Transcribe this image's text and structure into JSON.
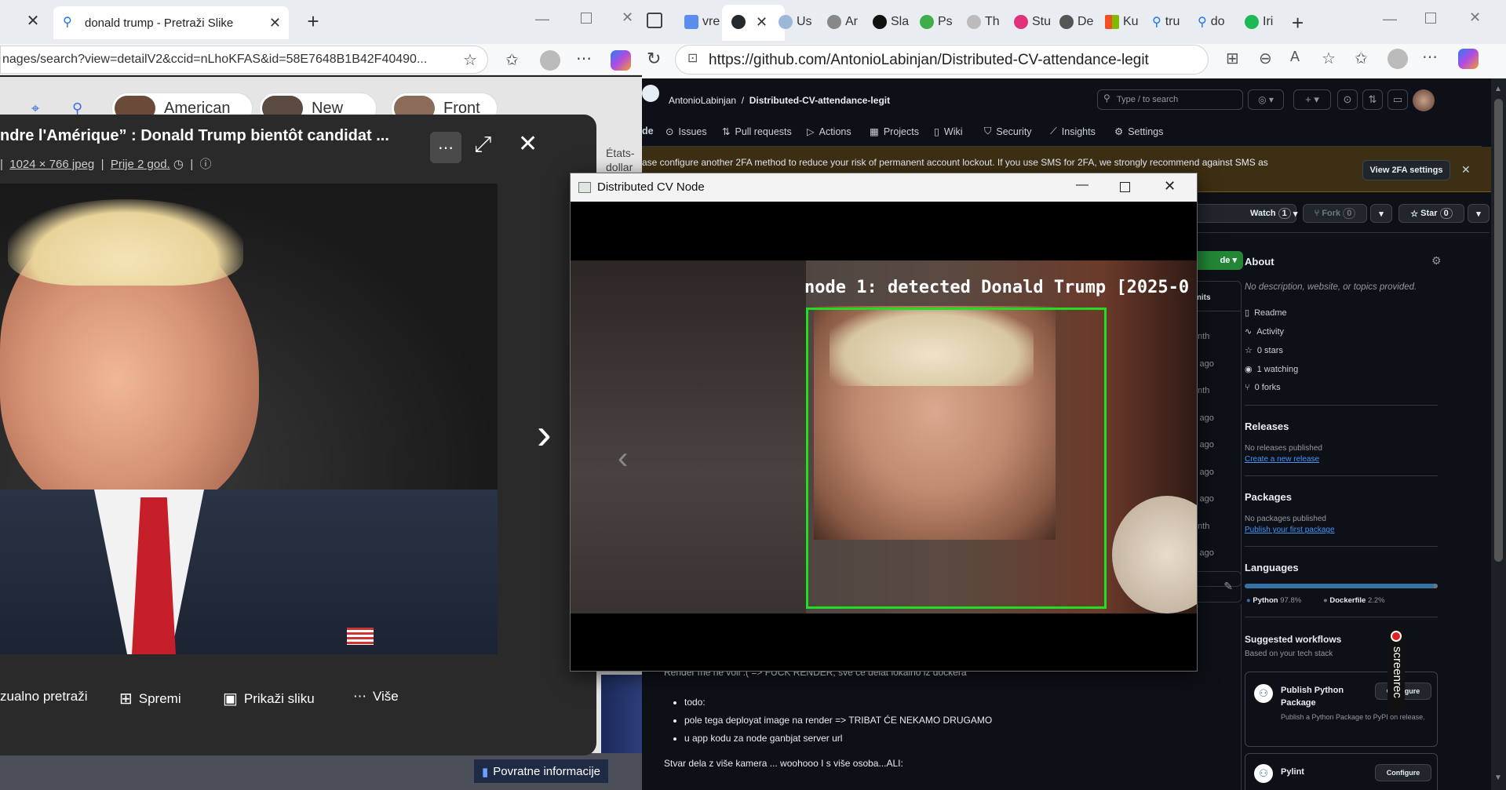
{
  "left_browser": {
    "tab_title": "donald trump - Pretraži Slike",
    "url": "nages/search?view=detailV2&ccid=nLhoKFAS&id=58E7648B1B42F40490...",
    "chips": [
      "American",
      "New",
      "Front"
    ],
    "image_title": "ndre l'Amérique” : Donald Trump bientôt candidat ...",
    "image_size": "1024 × 766 jpeg",
    "image_age": "Prije 2 god.",
    "side_text": [
      "États-",
      "dollar"
    ],
    "actions": [
      "zualno pretraži",
      "Spremi",
      "Prikaži sliku",
      "Više"
    ],
    "feedback": "Povratne informacije"
  },
  "right_browser": {
    "tabs": [
      {
        "label": "vre",
        "color": "#5b8def"
      },
      {
        "label": "",
        "color": "#24292f"
      },
      {
        "label": "Us",
        "color": "#9bb8d9"
      },
      {
        "label": "Ar",
        "color": "#888888"
      },
      {
        "label": "Sla",
        "color": "#111111"
      },
      {
        "label": "Ps",
        "color": "#3fae4a"
      },
      {
        "label": "Th",
        "color": "#bbbbbb"
      },
      {
        "label": "Stu",
        "color": "#e0317a"
      },
      {
        "label": "De",
        "color": "#555555"
      },
      {
        "label": "Ku",
        "color": "#f25022"
      },
      {
        "label": "tru",
        "color": "#1a73e8"
      },
      {
        "label": "do",
        "color": "#1a73e8"
      },
      {
        "label": "Iri",
        "color": "#1db954"
      }
    ],
    "url": "https://github.com/AntonioLabinjan/Distributed-CV-attendance-legit"
  },
  "github": {
    "owner": "AntonioLabinjan",
    "repo": "Distributed-CV-attendance-legit",
    "search_placeholder": "Type / to search",
    "nav": [
      "de",
      "Issues",
      "Pull requests",
      "Actions",
      "Projects",
      "Wiki",
      "Security",
      "Insights",
      "Settings"
    ],
    "banner": "ase configure another 2FA method to reduce your risk of permanent account lockout. If you use SMS for 2FA, we strongly recommend against SMS as it is prone to fraud and",
    "banner_button": "View 2FA settings",
    "watch": "Watch",
    "watch_count": "1",
    "fork": "Fork",
    "fork_count": "0",
    "star": "Star",
    "star_count": "0",
    "code_btn": "de",
    "commits": "mits",
    "file_times": [
      "onth",
      "s ago",
      "onth",
      "s ago",
      "s ago",
      "s ago",
      "s ago",
      "onth",
      "s ago"
    ],
    "about": {
      "title": "About",
      "desc": "No description, website, or topics provided.",
      "links": [
        "Readme",
        "Activity",
        "0 stars",
        "1 watching",
        "0 forks"
      ]
    },
    "releases": {
      "title": "Releases",
      "text": "No releases published",
      "link": "Create a new release"
    },
    "packages": {
      "title": "Packages",
      "text": "No packages published",
      "link": "Publish your first package"
    },
    "languages": {
      "title": "Languages",
      "items": [
        {
          "name": "Python",
          "pct": "97.8%",
          "value": 97.8,
          "color": "#3572A5"
        },
        {
          "name": "Dockerfile",
          "pct": "2.2%",
          "value": 2.2,
          "color": "#384d54"
        }
      ]
    },
    "workflows": {
      "title": "Suggested workflows",
      "subtitle": "Based on your tech stack",
      "items": [
        {
          "name": "Publish Python Package",
          "desc": "Publish a Python Package to PyPI on release.",
          "button": "Configure"
        },
        {
          "name": "Pylint",
          "button": "Configure"
        }
      ]
    },
    "readme": {
      "line1": "Render me ne voli :( => FUCK RENDER, sve će delat lokalno iz dockera",
      "bullets": [
        "todo:",
        "pole tega deployat image na render => TRIBAT ĆE NEKAMO DRUGAMO",
        "u app kodu za node ganbjat server url"
      ],
      "line2": "Stvar dela z više kamera ... woohooo I s više osoba...ALI:"
    }
  },
  "cv_window": {
    "title": "Distributed CV Node",
    "detection": "node 1: detected Donald Trump [2025-0"
  },
  "screenrec": "screenrec"
}
